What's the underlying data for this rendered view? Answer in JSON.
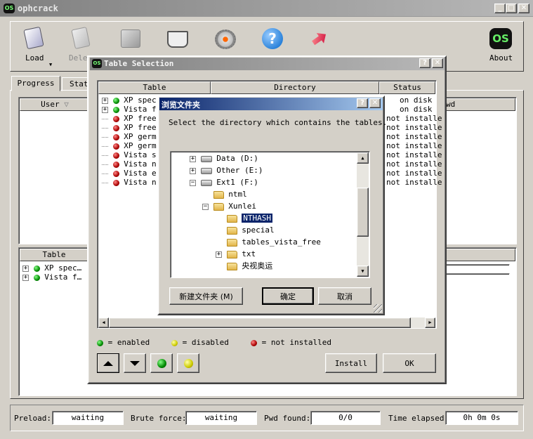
{
  "app": {
    "title": "ophcrack",
    "icon_text": "OS"
  },
  "toolbar": {
    "load_label": "Load",
    "delete_label": "Dele",
    "about_label": "About",
    "about_icon_text": "OS"
  },
  "main_tabs": {
    "progress": "Progress",
    "stat": "Stat"
  },
  "user_table": {
    "user_header": "User",
    "pwd_header": "wd"
  },
  "tables_panel": {
    "header": "Table",
    "rows": [
      {
        "label": "XP spec…",
        "status": "enabled"
      },
      {
        "label": "Vista f…",
        "status": "enabled"
      }
    ]
  },
  "status_bar": {
    "preload_label": "Preload:",
    "preload_value": "waiting",
    "brute_label": "Brute force:",
    "brute_value": "waiting",
    "pwd_label": "Pwd found:",
    "pwd_value": "0/0",
    "time_label": "Time elapsed:",
    "time_value": "0h 0m 0s"
  },
  "table_selection": {
    "title": "Table Selection",
    "help_btn": "?",
    "close_btn": "✕",
    "columns": {
      "table": "Table",
      "directory": "Directory",
      "status": "Status"
    },
    "rows": [
      {
        "name": "XP spec",
        "expand": "+",
        "dot": "g",
        "status": "on disk"
      },
      {
        "name": "Vista f",
        "expand": "+",
        "dot": "g",
        "status": "on disk"
      },
      {
        "name": "XP free",
        "expand": "",
        "dot": "r",
        "status": "not installe"
      },
      {
        "name": "XP free",
        "expand": "",
        "dot": "r",
        "status": "not installe"
      },
      {
        "name": "XP germ",
        "expand": "",
        "dot": "r",
        "status": "not installe"
      },
      {
        "name": "XP germ",
        "expand": "",
        "dot": "r",
        "status": "not installe"
      },
      {
        "name": "Vista s",
        "expand": "",
        "dot": "r",
        "status": "not installe"
      },
      {
        "name": "Vista n",
        "expand": "",
        "dot": "r",
        "status": "not installe"
      },
      {
        "name": "Vista e",
        "expand": "",
        "dot": "r",
        "status": "not installe"
      },
      {
        "name": "Vista n",
        "expand": "",
        "dot": "r",
        "status": "not installe"
      }
    ],
    "legend": {
      "enabled": "= enabled",
      "disabled": "= disabled",
      "not_installed": "= not installed"
    },
    "install_btn": "Install",
    "ok_btn": "OK"
  },
  "browse": {
    "title": "浏览文件夹",
    "help_btn": "?",
    "close_btn": "✕",
    "prompt": "Select the directory which contains the tables.",
    "tree": [
      {
        "label": "Data (D:)",
        "type": "drive",
        "expand": "+",
        "selected": false
      },
      {
        "label": "Other (E:)",
        "type": "drive",
        "expand": "+",
        "selected": false
      },
      {
        "label": "Ext1 (F:)",
        "type": "drive",
        "expand": "−",
        "selected": false
      },
      {
        "label": "ntml",
        "type": "folder",
        "expand": "",
        "selected": false
      },
      {
        "label": "Xunlei",
        "type": "folder-open",
        "expand": "−",
        "selected": false
      },
      {
        "label": "NTHASH",
        "type": "folder",
        "expand": "",
        "selected": true
      },
      {
        "label": "special",
        "type": "folder",
        "expand": "",
        "selected": false
      },
      {
        "label": "tables_vista_free",
        "type": "folder",
        "expand": "",
        "selected": false
      },
      {
        "label": "txt",
        "type": "folder",
        "expand": "+",
        "selected": false
      },
      {
        "label": "央视奥运",
        "type": "folder",
        "expand": "",
        "selected": false
      }
    ],
    "new_folder_btn": "新建文件夹 (M)",
    "ok_btn": "确定",
    "cancel_btn": "取消"
  }
}
